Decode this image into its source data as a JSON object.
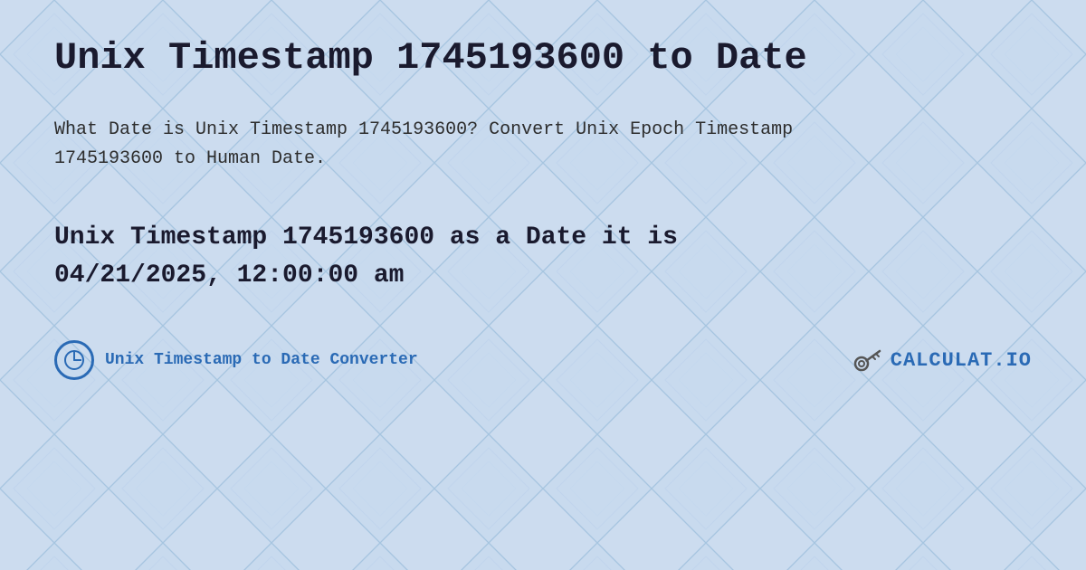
{
  "page": {
    "title": "Unix Timestamp 1745193600 to Date",
    "description": "What Date is Unix Timestamp 1745193600? Convert Unix Epoch Timestamp 1745193600 to Human Date.",
    "result_line1": "Unix Timestamp 1745193600 as a Date it is",
    "result_line2": "04/21/2025, 12:00:00 am",
    "footer_label": "Unix Timestamp to Date Converter",
    "logo_text": "CALCULAT.IO",
    "logo_prefix": "ᐳ",
    "background_color": "#c8daf0",
    "accent_color": "#2a6ab5"
  }
}
